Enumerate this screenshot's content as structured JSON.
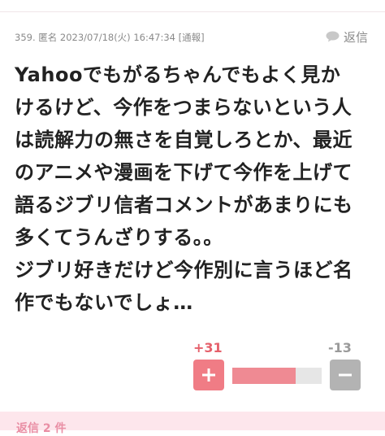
{
  "top": {
    "cut_text": ""
  },
  "comment": {
    "meta": "359. 匿名 2023/07/18(火) 16:47:34",
    "report_label": "[通報]",
    "reply_label": "返信",
    "lines": [
      "Yahooでもがるちゃんでもよく見か",
      "けるけど、今作をつまらないという人",
      "は読解力の無さを自覚しろとか、最近",
      "のアニメや漫画を下げて今作を上げて",
      "語るジブリ信者コメントがあまりにも",
      "多くてうんざりする。。",
      "ジブリ好きだけど今作別に言うほど名",
      "作でもないでしょ…"
    ]
  },
  "votes": {
    "plus_count": "+31",
    "minus_count": "-13",
    "plus_ratio": 0.705
  },
  "replies": {
    "label": "返信 2 件"
  },
  "colors": {
    "accent": "#f07c85",
    "plus_text": "#e5606b",
    "neutral": "#b3b3b3",
    "replies_bg": "#fde6ec"
  },
  "icons": {
    "reply": "speech-bubble-icon",
    "plus": "plus-icon",
    "minus": "minus-icon"
  }
}
